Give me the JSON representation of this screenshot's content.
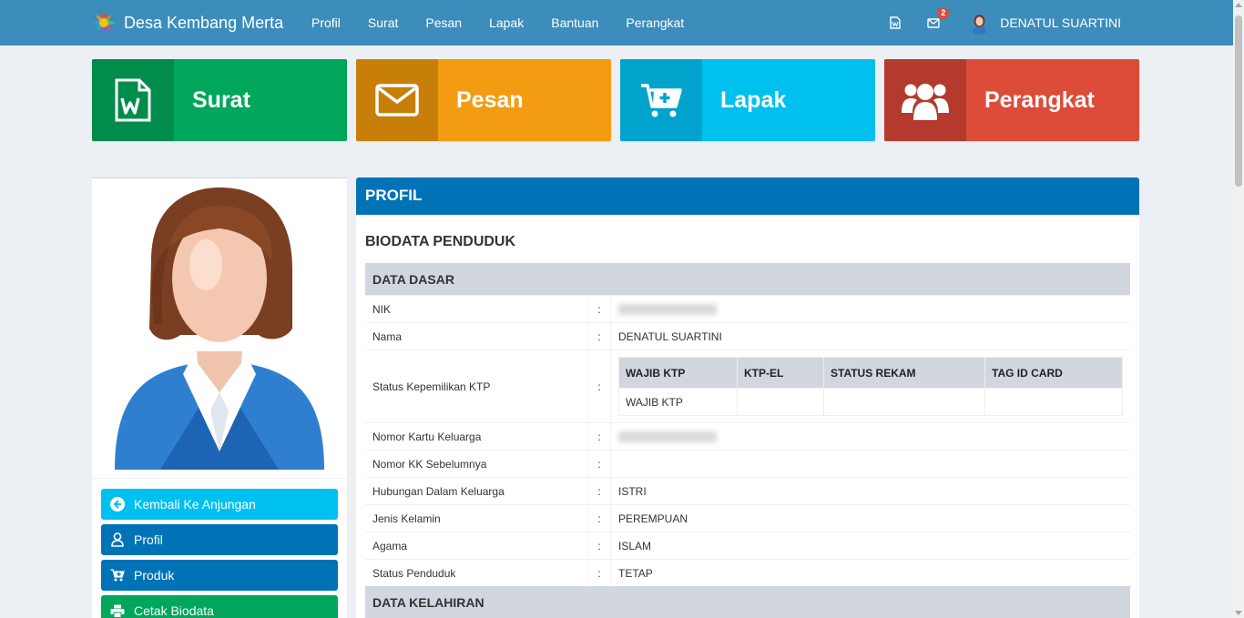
{
  "brand": {
    "title": "Desa Kembang Merta"
  },
  "nav": {
    "items": [
      "Profil",
      "Surat",
      "Pesan",
      "Lapak",
      "Bantuan",
      "Perangkat"
    ]
  },
  "notifications": {
    "message_count": "2"
  },
  "user": {
    "name": "DENATUL SUARTINI"
  },
  "boxes": [
    {
      "label": "Surat",
      "icon": "word-file-icon",
      "color": "#00a65a",
      "icon_bg": "#008d4c"
    },
    {
      "label": "Pesan",
      "icon": "envelope-icon",
      "color": "#f39c12",
      "icon_bg": "#c87f0a"
    },
    {
      "label": "Lapak",
      "icon": "cart-plus-icon",
      "color": "#00c0ef",
      "icon_bg": "#00a3cb"
    },
    {
      "label": "Perangkat",
      "icon": "users-icon",
      "color": "#dd4b39",
      "icon_bg": "#b33a2c"
    }
  ],
  "sidebar": {
    "buttons": [
      {
        "label": "Kembali Ke Anjungan",
        "color": "#00c0ef"
      },
      {
        "label": "Profil",
        "color": "#0073b7"
      },
      {
        "label": "Produk",
        "color": "#0073b7"
      },
      {
        "label": "Cetak Biodata",
        "color": "#00a65a"
      }
    ]
  },
  "panel": {
    "header": "PROFIL",
    "section_title": "BIODATA PENDUDUK",
    "group_dasar": "DATA DASAR",
    "group_kelahiran": "DATA KELAHIRAN",
    "separator": ":",
    "rows": {
      "nik": {
        "label": "NIK"
      },
      "nama": {
        "label": "Nama",
        "value": "DENATUL SUARTINI"
      },
      "ktp": {
        "label": "Status Kepemilikan KTP"
      },
      "kk": {
        "label": "Nomor Kartu Keluarga"
      },
      "kk_prev": {
        "label": "Nomor KK Sebelumnya",
        "value": ""
      },
      "hubungan": {
        "label": "Hubungan Dalam Keluarga",
        "value": "ISTRI"
      },
      "kelamin": {
        "label": "Jenis Kelamin",
        "value": "PEREMPUAN"
      },
      "agama": {
        "label": "Agama",
        "value": "ISLAM"
      },
      "status": {
        "label": "Status Penduduk",
        "value": "TETAP"
      }
    },
    "ktp_table": {
      "headers": [
        "WAJIB KTP",
        "KTP-EL",
        "STATUS REKAM",
        "TAG ID CARD"
      ],
      "row": [
        "WAJIB KTP",
        "",
        "",
        ""
      ]
    }
  }
}
